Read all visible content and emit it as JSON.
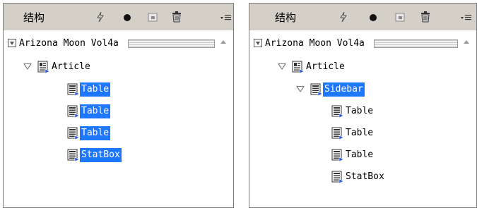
{
  "panels": [
    {
      "title": "结构",
      "root": "Arizona Moon Vol4a",
      "article": "Article",
      "items": [
        "Table",
        "Table",
        "Table",
        "StatBox"
      ]
    },
    {
      "title": "结构",
      "root": "Arizona Moon Vol4a",
      "article": "Article",
      "sidebar": "Sidebar",
      "items": [
        "Table",
        "Table",
        "Table",
        "StatBox"
      ]
    }
  ],
  "icons": [
    "lightning-icon",
    "circle-icon",
    "tag-icon",
    "trash-icon",
    "panel-menu-icon"
  ],
  "colors": {
    "selection": "#1e78ff",
    "toolbar": "#d4d0c8"
  }
}
